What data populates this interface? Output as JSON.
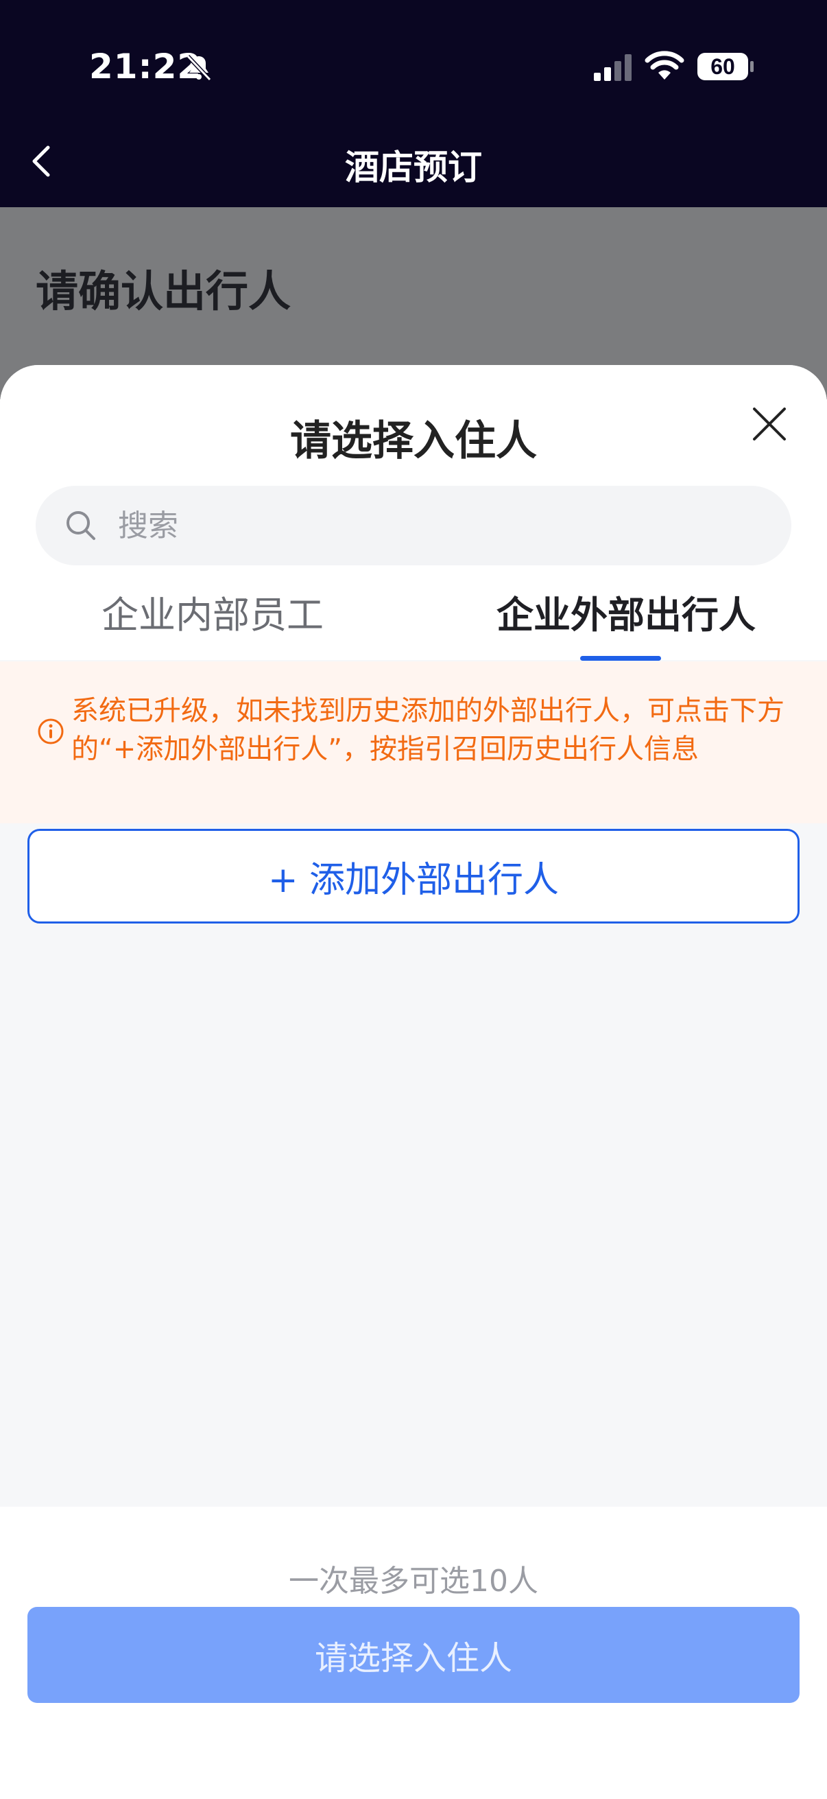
{
  "status_bar": {
    "time": "21:22",
    "battery": "60"
  },
  "nav": {
    "title": "酒店预订"
  },
  "background_page": {
    "title": "请确认出行人"
  },
  "sheet": {
    "title": "请选择入住人",
    "search": {
      "placeholder": "搜索"
    },
    "tabs": [
      {
        "label": "企业内部员工",
        "active": false
      },
      {
        "label": "企业外部出行人",
        "active": true
      }
    ],
    "notice": "系统已升级，如未找到历史添加的外部出行人，可点击下方的“+添加外部出行人”，按指引召回历史出行人信息",
    "add_button": "+ 添加外部出行人",
    "footer_hint": "一次最多可选10人",
    "confirm_button": "请选择入住人"
  },
  "colors": {
    "accent": "#1f5fe8",
    "header_bg": "#0a0622",
    "notice_text": "#f26a12",
    "notice_bg": "#fff5f0",
    "confirm_bg": "#78a2fb"
  }
}
